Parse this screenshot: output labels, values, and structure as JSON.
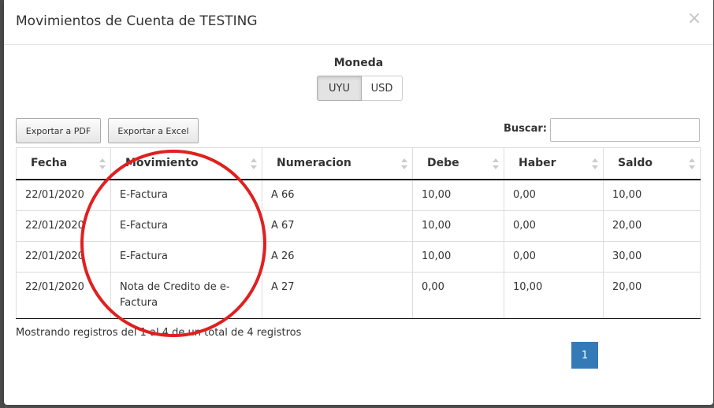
{
  "modal": {
    "title": "Movimientos de Cuenta de TESTING",
    "close_label": "×"
  },
  "currency": {
    "label": "Moneda",
    "options": [
      "UYU",
      "USD"
    ],
    "selected": "UYU"
  },
  "toolbar": {
    "export_pdf_label": "Exportar a PDF",
    "export_excel_label": "Exportar a Excel",
    "search_label": "Buscar:",
    "search_value": ""
  },
  "table": {
    "headers": [
      "Fecha",
      "Movimiento",
      "Numeracion",
      "Debe",
      "Haber",
      "Saldo"
    ],
    "rows": [
      [
        "22/01/2020",
        "E-Factura",
        "A 66",
        "10,00",
        "0,00",
        "10,00"
      ],
      [
        "22/01/2020",
        "E-Factura",
        "A 67",
        "10,00",
        "0,00",
        "20,00"
      ],
      [
        "22/01/2020",
        "E-Factura",
        "A 26",
        "10,00",
        "0,00",
        "30,00"
      ],
      [
        "22/01/2020",
        "Nota de Credito de e-Factura",
        "A 27",
        "0,00",
        "10,00",
        "20,00"
      ]
    ]
  },
  "footer": {
    "info_text": "Mostrando registros del 1 al 4 de un total de 4 registros",
    "current_page": "1"
  },
  "colors": {
    "page_active": "#337ab7",
    "annotation": "#e02020"
  }
}
